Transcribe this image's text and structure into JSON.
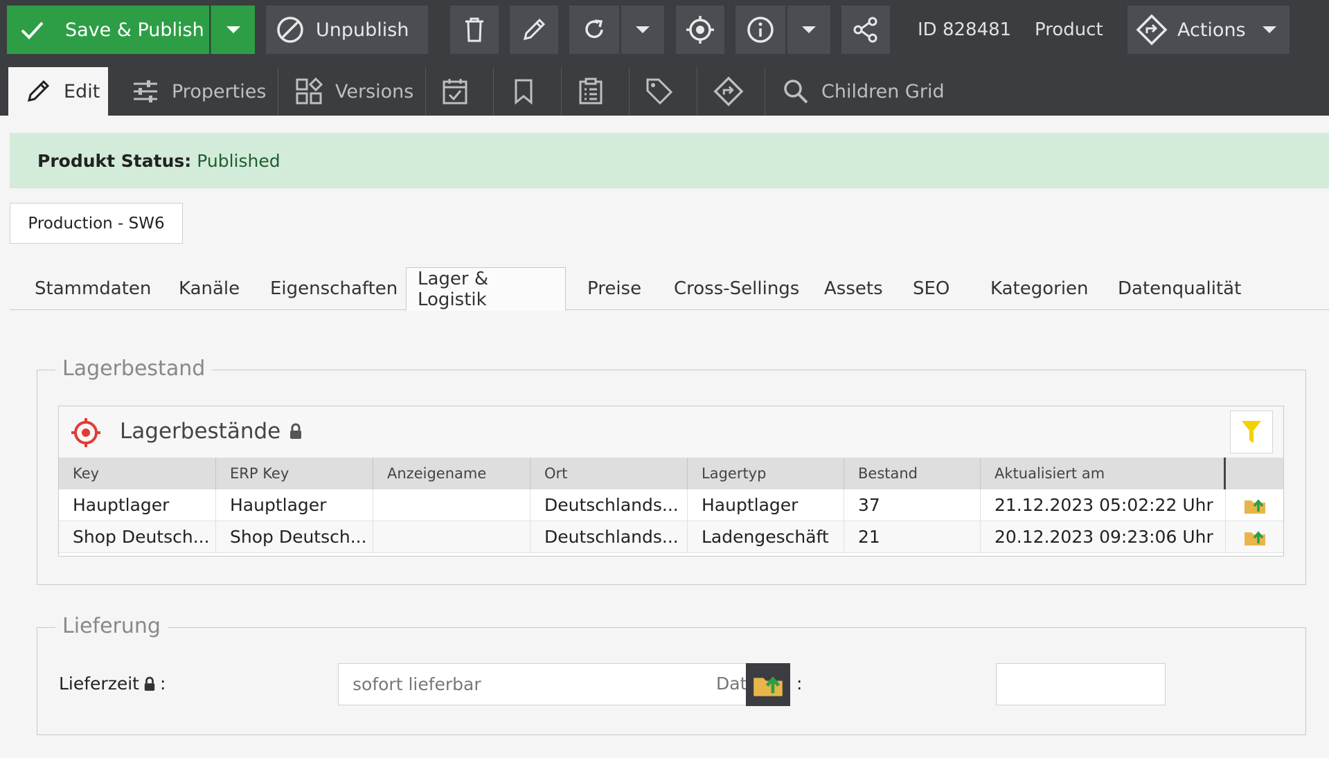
{
  "toolbar": {
    "save_label": "Save & Publish",
    "unpublish_label": "Unpublish",
    "id_label": "ID 828481",
    "type_label": "Product",
    "actions_label": "Actions"
  },
  "tabs2": {
    "edit": "Edit",
    "properties": "Properties",
    "versions": "Versions",
    "children_grid": "Children Grid"
  },
  "status": {
    "label": "Produkt Status:",
    "value": "Published"
  },
  "environment": "Production - SW6",
  "main_tabs": [
    "Stammdaten",
    "Kanäle",
    "Eigenschaften",
    "Lager & Logistik",
    "Preise",
    "Cross-Sellings",
    "Assets",
    "SEO",
    "Kategorien",
    "Datenqualität"
  ],
  "lagerbestand": {
    "legend": "Lagerbestand",
    "grid_title": "Lagerbestände",
    "columns": [
      "Key",
      "ERP Key",
      "Anzeigename",
      "Ort",
      "Lagertyp",
      "Bestand",
      "Aktualisiert am"
    ],
    "rows": [
      [
        "Hauptlager",
        "Hauptlager",
        "",
        "Deutschlands...",
        "Hauptlager",
        "37",
        "21.12.2023 05:02:22 Uhr"
      ],
      [
        "Shop Deutsch...",
        "Shop Deutsch...",
        "",
        "Deutschlands...",
        "Ladengeschäft",
        "21",
        "20.12.2023 09:23:06 Uhr"
      ]
    ]
  },
  "lieferung": {
    "legend": "Lieferung",
    "lieferzeit_label": "Lieferzeit",
    "colon": ":",
    "lieferzeit_value": "sofort lieferbar",
    "date_label": "Dat",
    "date_colon": ":"
  },
  "colors": {
    "toolbar_bg": "#3b3d40",
    "accent_green": "#2e9e46",
    "status_bg": "#d3ebd9",
    "target_red": "#e53935",
    "filter_yellow": "#f5d000"
  }
}
